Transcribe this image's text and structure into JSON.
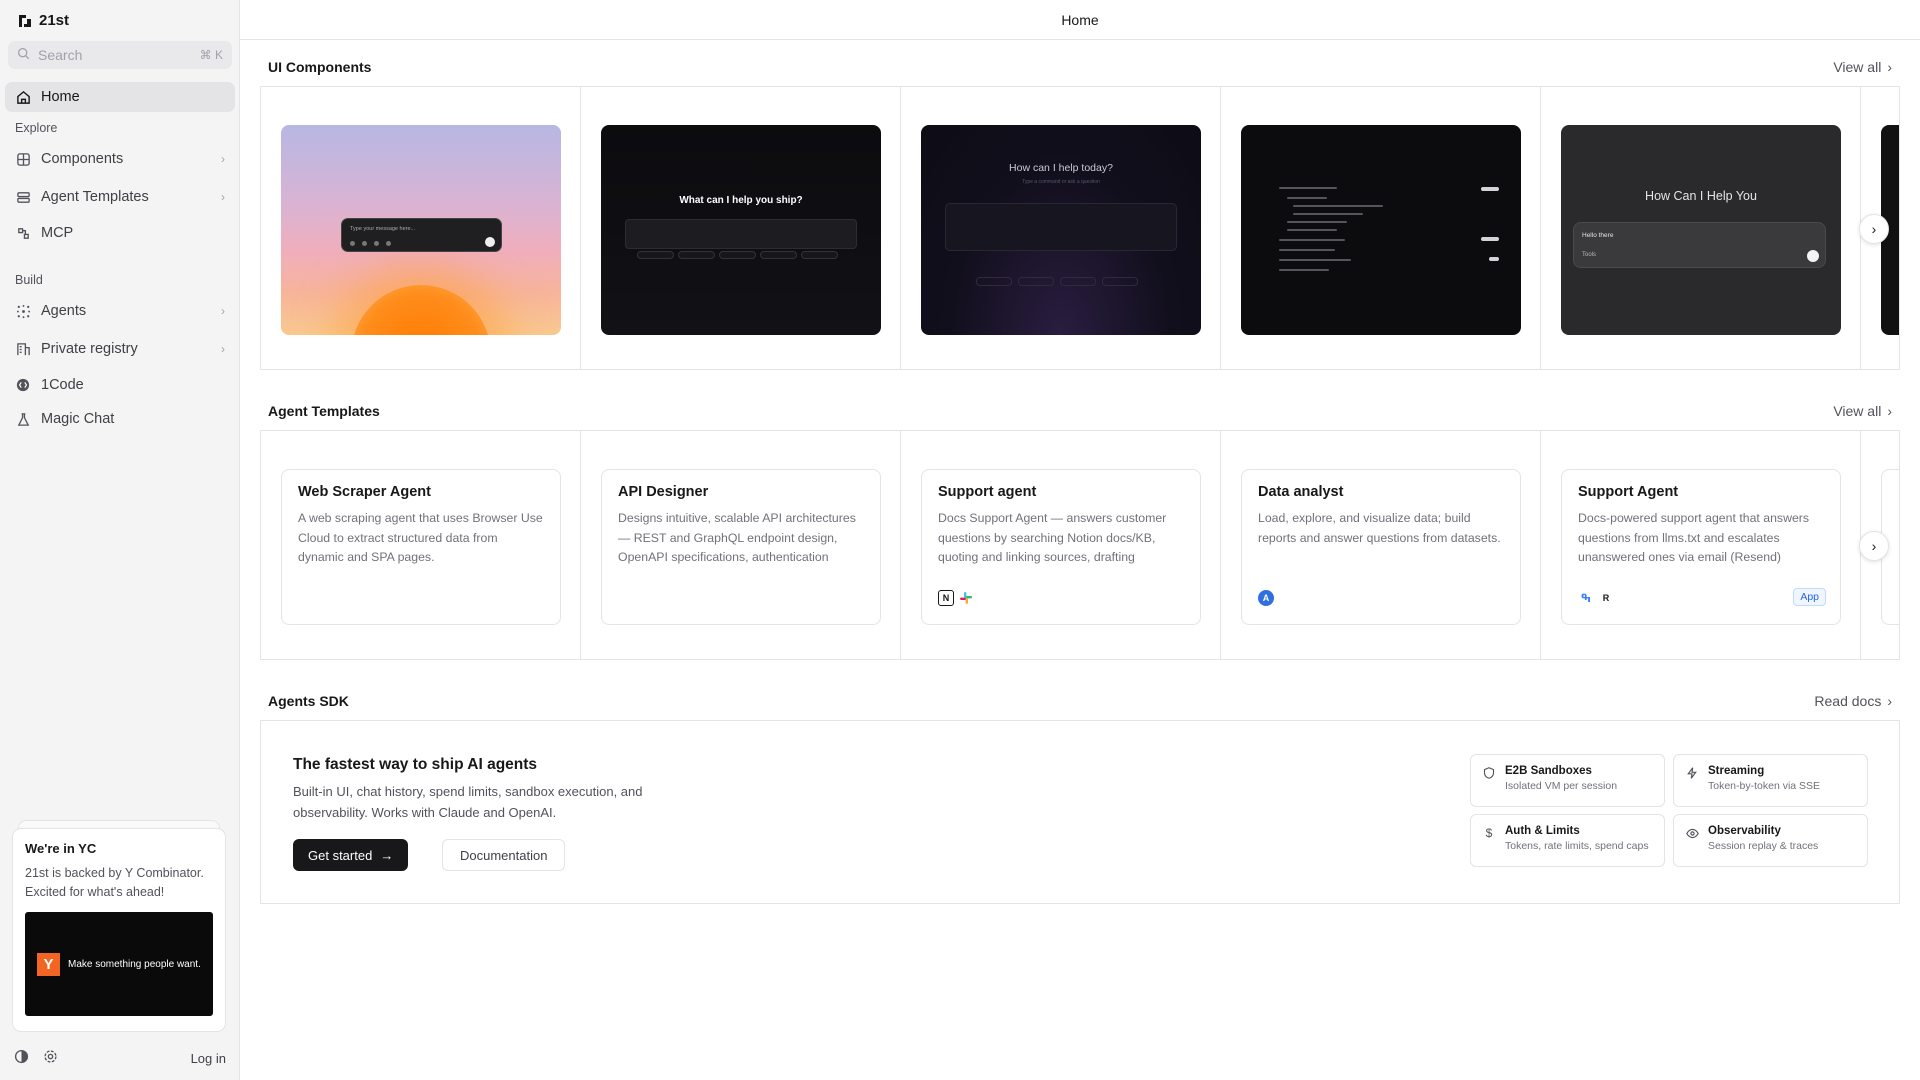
{
  "app": {
    "name": "21st",
    "page_title": "Home"
  },
  "search": {
    "placeholder": "Search",
    "shortcut": "⌘ K"
  },
  "sidebar": {
    "home": "Home",
    "explore_label": "Explore",
    "explore_items": [
      {
        "label": "Components",
        "icon": "grid-icon"
      },
      {
        "label": "Agent Templates",
        "icon": "layers-icon"
      },
      {
        "label": "MCP",
        "icon": "plug-icon"
      }
    ],
    "build_label": "Build",
    "build_items": [
      {
        "label": "Agents",
        "icon": "agents-icon"
      },
      {
        "label": "Private registry",
        "icon": "building-icon"
      },
      {
        "label": "1Code",
        "icon": "code-icon"
      },
      {
        "label": "Magic Chat",
        "icon": "flask-icon"
      }
    ],
    "yc": {
      "title": "We're in YC",
      "text": "21st is backed by Y Combinator. Excited for what's ahead!",
      "logo_letter": "Y",
      "banner_text": "Make something people want."
    },
    "login": "Log in"
  },
  "ui_components": {
    "title": "UI Components",
    "view_all": "View all",
    "previews": [
      {
        "placeholder": "Type your message here..."
      },
      {
        "heading": "What can I help you ship?"
      },
      {
        "heading": "How can I help today?",
        "sub": "Type a command or ask a question"
      },
      {
        "heading": ""
      },
      {
        "heading": "How Can I Help You",
        "input_text": "Hello there",
        "tools": "Tools"
      }
    ]
  },
  "agent_templates": {
    "title": "Agent Templates",
    "view_all": "View all",
    "cards": [
      {
        "title": "Web Scraper Agent",
        "desc": "A web scraping agent that uses Browser Use Cloud to extract structured data from dynamic and SPA pages."
      },
      {
        "title": "API Designer",
        "desc": "Designs intuitive, scalable API architectures — REST and GraphQL endpoint design, OpenAPI specifications, authentication patterns,..."
      },
      {
        "title": "Support agent",
        "desc": "Docs Support Agent — answers customer questions by searching Notion docs/KB, quoting and linking sources, drafting replies..."
      },
      {
        "title": "Data analyst",
        "desc": "Load, explore, and visualize data; build reports and answer questions from datasets."
      },
      {
        "title": "Support Agent",
        "desc": "Docs-powered support agent that answers questions from llms.txt and escalates unanswered ones via email (Resend)",
        "badge": "App"
      }
    ]
  },
  "sdk": {
    "title": "Agents SDK",
    "read_docs": "Read docs",
    "headline": "The fastest way to ship AI agents",
    "desc": "Built-in UI, chat history, spend limits, sandbox execution, and observability. Works with Claude and OpenAI.",
    "primary": "Get started",
    "secondary": "Documentation",
    "features": [
      {
        "title": "E2B Sandboxes",
        "sub": "Isolated VM per session",
        "icon": "shield-icon"
      },
      {
        "title": "Streaming",
        "sub": "Token-by-token via SSE",
        "icon": "bolt-icon"
      },
      {
        "title": "Auth & Limits",
        "sub": "Tokens, rate limits, spend caps",
        "icon": "dollar-icon"
      },
      {
        "title": "Observability",
        "sub": "Session replay & traces",
        "icon": "eye-icon"
      }
    ]
  }
}
